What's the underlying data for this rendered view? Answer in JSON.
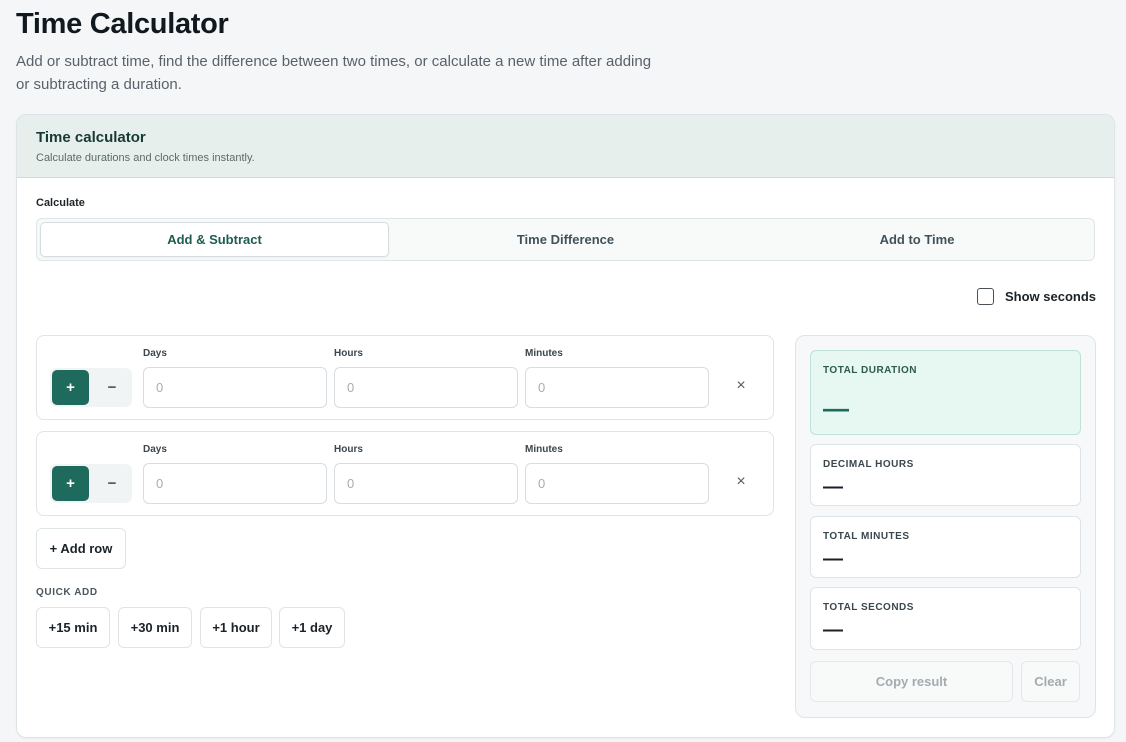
{
  "page": {
    "title": "Time Calculator",
    "description": "Add or subtract time, find the difference between two times, or calculate a new time after adding or subtracting a duration."
  },
  "card": {
    "title": "Time calculator",
    "subtitle": "Calculate durations and clock times instantly."
  },
  "calculate_label": "Calculate",
  "tabs": [
    {
      "label": "Add & Subtract",
      "active": true
    },
    {
      "label": "Time Difference",
      "active": false
    },
    {
      "label": "Add to Time",
      "active": false
    }
  ],
  "show_seconds": {
    "label": "Show seconds",
    "checked": false
  },
  "rows": [
    {
      "plus": "+",
      "minus": "−",
      "fields": [
        {
          "label": "Days",
          "placeholder": "0",
          "value": ""
        },
        {
          "label": "Hours",
          "placeholder": "0",
          "value": ""
        },
        {
          "label": "Minutes",
          "placeholder": "0",
          "value": ""
        }
      ],
      "remove": "×"
    },
    {
      "plus": "+",
      "minus": "−",
      "fields": [
        {
          "label": "Days",
          "placeholder": "0",
          "value": ""
        },
        {
          "label": "Hours",
          "placeholder": "0",
          "value": ""
        },
        {
          "label": "Minutes",
          "placeholder": "0",
          "value": ""
        }
      ],
      "remove": "×"
    }
  ],
  "add_row_label": "+  Add row",
  "quick_add": {
    "label": "QUICK ADD",
    "buttons": [
      "+15 min",
      "+30 min",
      "+1 hour",
      "+1 day"
    ]
  },
  "results": [
    {
      "label": "TOTAL DURATION",
      "value": "—"
    },
    {
      "label": "DECIMAL HOURS",
      "value": "—"
    },
    {
      "label": "TOTAL MINUTES",
      "value": "—"
    },
    {
      "label": "TOTAL SECONDS",
      "value": "—"
    }
  ],
  "actions": {
    "copy": "Copy result",
    "clear": "Clear"
  },
  "colors": {
    "accent": "#1e6b5e",
    "header_bg": "#e6efec",
    "primary_result_bg": "#e7f7f2"
  }
}
